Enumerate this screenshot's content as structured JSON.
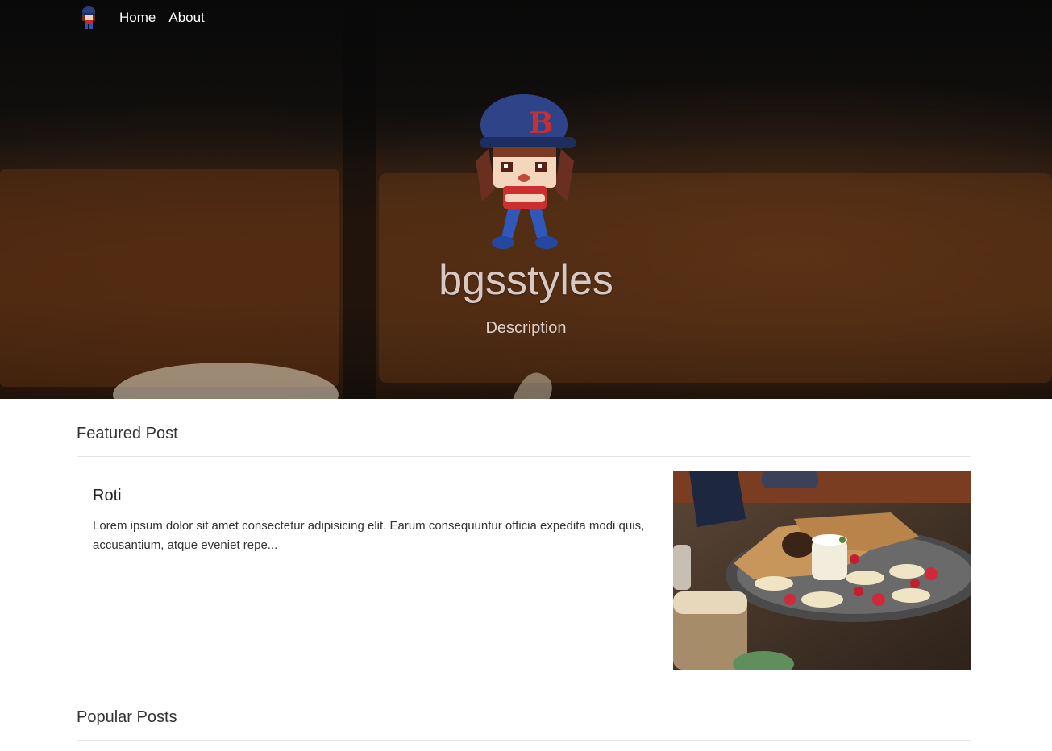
{
  "nav": {
    "logo_icon": "mascot-avatar-icon",
    "links": [
      "Home",
      "About"
    ]
  },
  "hero": {
    "title": "bgsstyles",
    "description": "Description",
    "mascot_icon": "pixel-boy-baseball-cap-icon"
  },
  "featured": {
    "heading": "Featured Post",
    "post": {
      "title": "Roti",
      "excerpt": "Lorem ipsum dolor sit amet consectetur adipisicing elit. Earum consequuntur officia expedita modi quis, accusantium, atque eveniet repe...",
      "image_icon": "food-plate-photo"
    }
  },
  "popular": {
    "heading": "Popular Posts"
  },
  "colors": {
    "title_text": "#d8c8c4",
    "nav_text": "#ffffff",
    "divider": "#e4e4e4"
  }
}
